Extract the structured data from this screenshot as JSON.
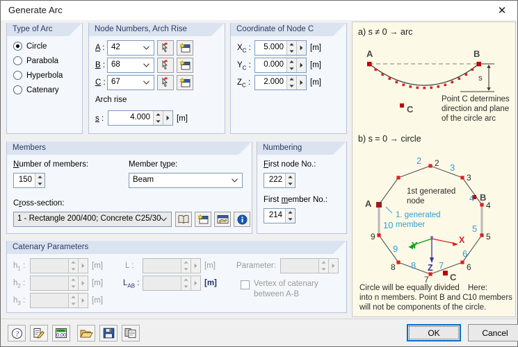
{
  "window": {
    "title": "Generate Arc",
    "close_icon": "close-icon"
  },
  "type_of_arc": {
    "legend": "Type of Arc",
    "options": [
      {
        "label": "Circle",
        "selected": true
      },
      {
        "label": "Parabola",
        "selected": false
      },
      {
        "label": "Hyperbola",
        "selected": false
      },
      {
        "label": "Catenary",
        "selected": false
      }
    ]
  },
  "node_numbers": {
    "legend": "Node Numbers, Arch Rise",
    "rows": [
      {
        "label": "A :",
        "value": "42"
      },
      {
        "label": "B :",
        "value": "68"
      },
      {
        "label": "C :",
        "value": "67"
      }
    ],
    "pick_icon": "pick-node-icon",
    "new_icon": "new-node-icon",
    "arch_rise_label": "Arch rise",
    "s_label": "s :",
    "s_value": "4.000",
    "s_unit": "[m]"
  },
  "coordinate_node_c": {
    "legend": "Coordinate of Node C",
    "rows": [
      {
        "label": "X",
        "sub": "C",
        "suffix": " :",
        "value": "5.000",
        "unit": "[m]"
      },
      {
        "label": "Y",
        "sub": "C",
        "suffix": " :",
        "value": "0.000",
        "unit": "[m]"
      },
      {
        "label": "Z",
        "sub": "C",
        "suffix": " :",
        "value": "2.000",
        "unit": "[m]"
      }
    ]
  },
  "members": {
    "legend": "Members",
    "number_label": "Number of members:",
    "number_value": "150",
    "member_type_label": "Member type:",
    "member_type_value": "Beam",
    "cross_section_label": "Cross-section:",
    "cross_section_value": "1 - Rectangle 200/400; Concrete C25/30",
    "icons": [
      "library-icon",
      "new-section-icon",
      "edit-section-icon",
      "info-icon"
    ]
  },
  "numbering": {
    "legend": "Numbering",
    "first_node_label": "First node No.:",
    "first_node_value": "222",
    "first_member_label": "First member No.:",
    "first_member_value": "214"
  },
  "catenary": {
    "legend": "Catenary Parameters",
    "h1_label": "h",
    "h1_sub": "1",
    "h2_label": "h",
    "h2_sub": "2",
    "h3_label": "h",
    "h3_sub": "3",
    "colon": " :",
    "unit": "[m]",
    "l_label": "L :",
    "lab_label": "L",
    "lab_sub": "AB",
    "lab_colon": " :",
    "parameter_label": "Parameter:",
    "vertex_label_line1": "Vertex of catenary",
    "vertex_label_line2": "between A-B",
    "values": {
      "h1": "",
      "h2": "",
      "h3": "",
      "l": "",
      "lab": "",
      "parameter": ""
    }
  },
  "illustration": {
    "caption_a": "a) s ≠ 0 → arc",
    "caption_b": "b) s = 0 → circle",
    "arc": {
      "label_a": "A",
      "label_b": "B",
      "label_c": "C",
      "label_s": "s",
      "note_line1": "Point C determines",
      "note_line2": "direction and plane",
      "note_line3": "of the circle arc"
    },
    "circle": {
      "label_a": "A",
      "label_b": "B",
      "label_c": "C",
      "node_labels": [
        "2",
        "3",
        "4",
        "5",
        "6",
        "7",
        "8",
        "9"
      ],
      "member_labels": [
        "2",
        "3",
        "4",
        "5",
        "6",
        "7",
        "8",
        "9",
        "10"
      ],
      "note_node_line1": "1st generated",
      "note_node_line2": "node",
      "note_member_line1": "1. generated",
      "note_member_line2": "member",
      "axis_x": "X",
      "axis_y": "Y",
      "axis_z": "Z",
      "here_line1": "Here:",
      "here_line2": "10 members"
    },
    "footnote_line1": "Circle will be equally divided",
    "footnote_line2": "into n members. Point B and C",
    "footnote_line3": "will not be components of the circle."
  },
  "footer": {
    "toolbar": [
      {
        "name": "help-icon",
        "title": "Help"
      },
      {
        "name": "edit-icon",
        "title": "Edit"
      },
      {
        "name": "units-icon",
        "title": "Units"
      },
      {
        "name": "open-icon",
        "title": "Open"
      },
      {
        "name": "save-icon",
        "title": "Save"
      },
      {
        "name": "copy-icon",
        "title": "Copy"
      }
    ],
    "ok_label": "OK",
    "cancel_label": "Cancel"
  },
  "colors": {
    "group_header": "#dbe3f1",
    "group_header_text": "#2b3c63",
    "accent_blue": "#0a6cc4",
    "illustration_bg": "#fdf9e7",
    "node_red": "#e02020",
    "label_cyan": "#2e9fd8",
    "axis_x_red": "#e02020",
    "axis_y_green": "#00a000",
    "axis_z_blue": "#3b2fa0"
  }
}
